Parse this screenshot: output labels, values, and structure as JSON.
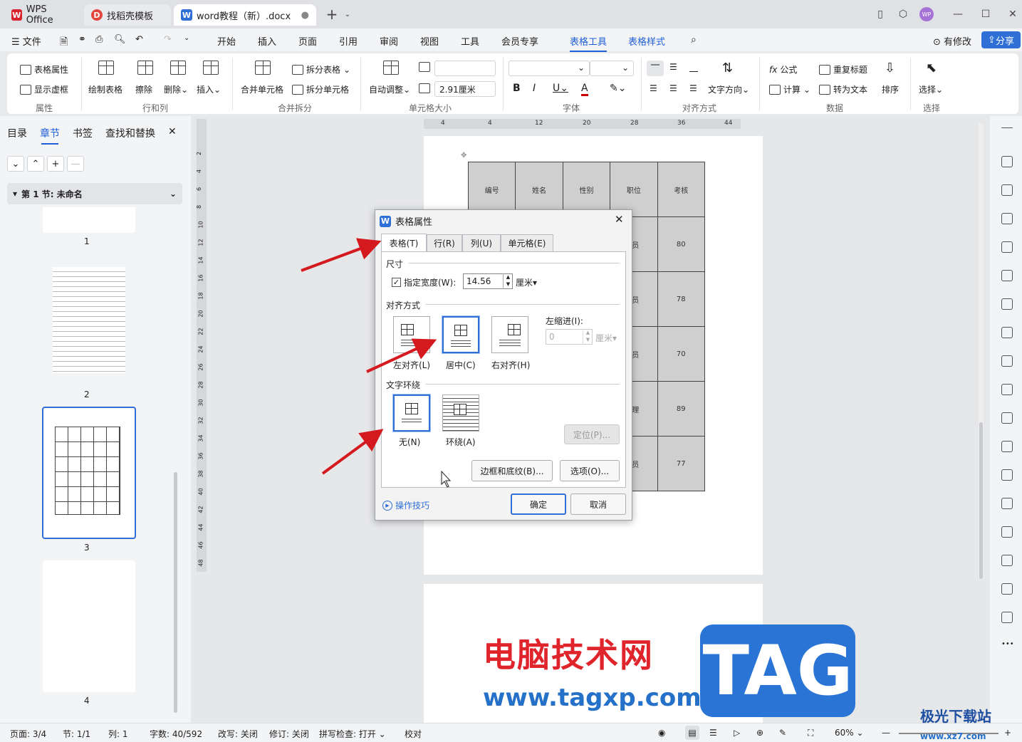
{
  "titlebar": {
    "tabs": [
      {
        "label": "WPS Office"
      },
      {
        "label": "找稻壳模板"
      },
      {
        "label": "word教程（新）.docx"
      }
    ],
    "avatar": "WP"
  },
  "menubar": {
    "file": "文件",
    "items": [
      "开始",
      "插入",
      "页面",
      "引用",
      "审阅",
      "视图",
      "工具",
      "会员专享"
    ],
    "context": [
      "表格工具",
      "表格样式"
    ],
    "modified": "有修改",
    "share": "分享"
  },
  "ribbon": {
    "table_props": "表格属性",
    "show_grid": "显示虚框",
    "group_props": "属性",
    "draw_table": "绘制表格",
    "erase": "擦除",
    "delete": "删除",
    "insert": "插入",
    "group_rowcol": "行和列",
    "merge_cells": "合并单元格",
    "split_table": "拆分表格",
    "split_cells": "拆分单元格",
    "group_merge": "合并拆分",
    "auto_fit": "自动调整",
    "cell_height": "2.91厘米",
    "group_cellsize": "单元格大小",
    "group_font": "字体",
    "text_dir": "文字方向",
    "group_align": "对齐方式",
    "formula": "公式",
    "calc": "计算",
    "repeat_header": "重复标题",
    "to_text": "转为文本",
    "sort": "排序",
    "group_data": "数据",
    "select": "选择",
    "group_select": "选择"
  },
  "leftpanel": {
    "tabs": [
      "目录",
      "章节",
      "书签",
      "查找和替换"
    ],
    "section": "第 1 节: 未命名",
    "pages": [
      "1",
      "2",
      "3",
      "4"
    ]
  },
  "ruler": {
    "top": [
      "4",
      "4",
      "12",
      "20",
      "28",
      "36",
      "44"
    ],
    "left": [
      "2",
      "4",
      "6",
      "8",
      "10",
      "12",
      "14",
      "16",
      "18",
      "20",
      "22",
      "24",
      "26",
      "28",
      "30",
      "32",
      "34",
      "36",
      "38",
      "40",
      "42",
      "44",
      "46",
      "48"
    ]
  },
  "doc_table": {
    "headers": [
      "编号",
      "姓名",
      "性别",
      "职位",
      "考核"
    ],
    "scores": [
      "80",
      "78",
      "70",
      "89",
      "77"
    ],
    "role_frag": [
      "员",
      "员",
      "员",
      "理",
      "员"
    ]
  },
  "dialog": {
    "title": "表格属性",
    "tabs": [
      "表格(T)",
      "行(R)",
      "列(U)",
      "单元格(E)"
    ],
    "size_label": "尺寸",
    "width_check": "指定宽度(W):",
    "width_value": "14.56",
    "unit": "厘米",
    "align_label": "对齐方式",
    "align_opts": [
      "左对齐(L)",
      "居中(C)",
      "右对齐(H)"
    ],
    "indent_label": "左缩进(I):",
    "indent_value": "0",
    "wrap_label": "文字环绕",
    "wrap_opts": [
      "无(N)",
      "环绕(A)"
    ],
    "position_btn": "定位(P)...",
    "border_btn": "边框和底纹(B)...",
    "options_btn": "选项(O)...",
    "tips": "操作技巧",
    "ok": "确定",
    "cancel": "取消"
  },
  "statusbar": {
    "page": "页面: 3/4",
    "section": "节: 1/1",
    "col": "列: 1",
    "words": "字数: 40/592",
    "rewrite": "改写: 关闭",
    "revision": "修订: 关闭",
    "spell": "拼写检查: 打开",
    "proof": "校对",
    "zoom": "60%"
  },
  "watermark": {
    "cn": "电脑技术网",
    "url": "www.tagxp.com",
    "tag": "TAG",
    "site2": "极光下载站",
    "site2_url": "www.xz7.com"
  }
}
